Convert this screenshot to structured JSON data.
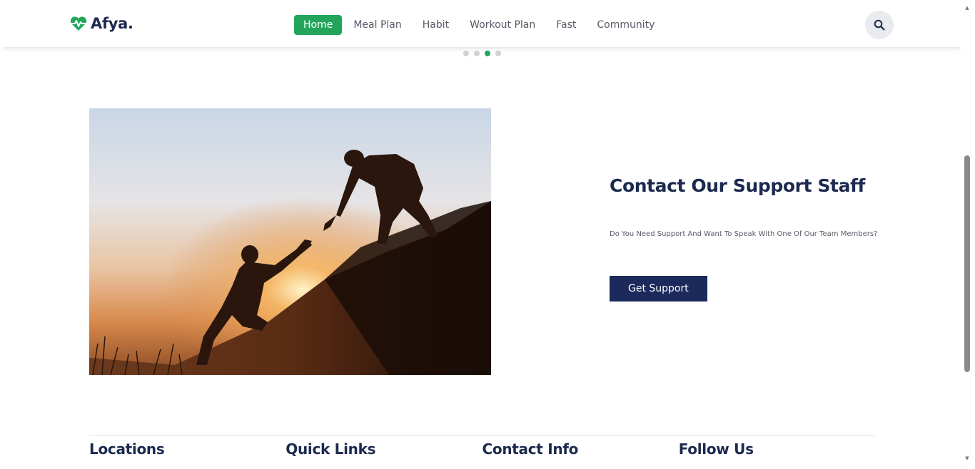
{
  "brand": {
    "name": "Afya.",
    "accent": "#22a55b",
    "navy": "#1b2a4e"
  },
  "nav": {
    "items": [
      {
        "label": "Home",
        "active": true
      },
      {
        "label": "Meal Plan"
      },
      {
        "label": "Habit"
      },
      {
        "label": "Workout Plan"
      },
      {
        "label": "Fast"
      },
      {
        "label": "Community"
      }
    ],
    "search_icon": "search-icon"
  },
  "carousel": {
    "dot_count": 4,
    "active_index": 2
  },
  "support": {
    "title": "Contact Our Support Staff",
    "description": "Do You Need Support And Want To Speak With One Of Our Team Members?",
    "button_label": "Get Support"
  },
  "footer": {
    "columns": [
      "Locations",
      "Quick Links",
      "Contact Info",
      "Follow Us"
    ]
  }
}
